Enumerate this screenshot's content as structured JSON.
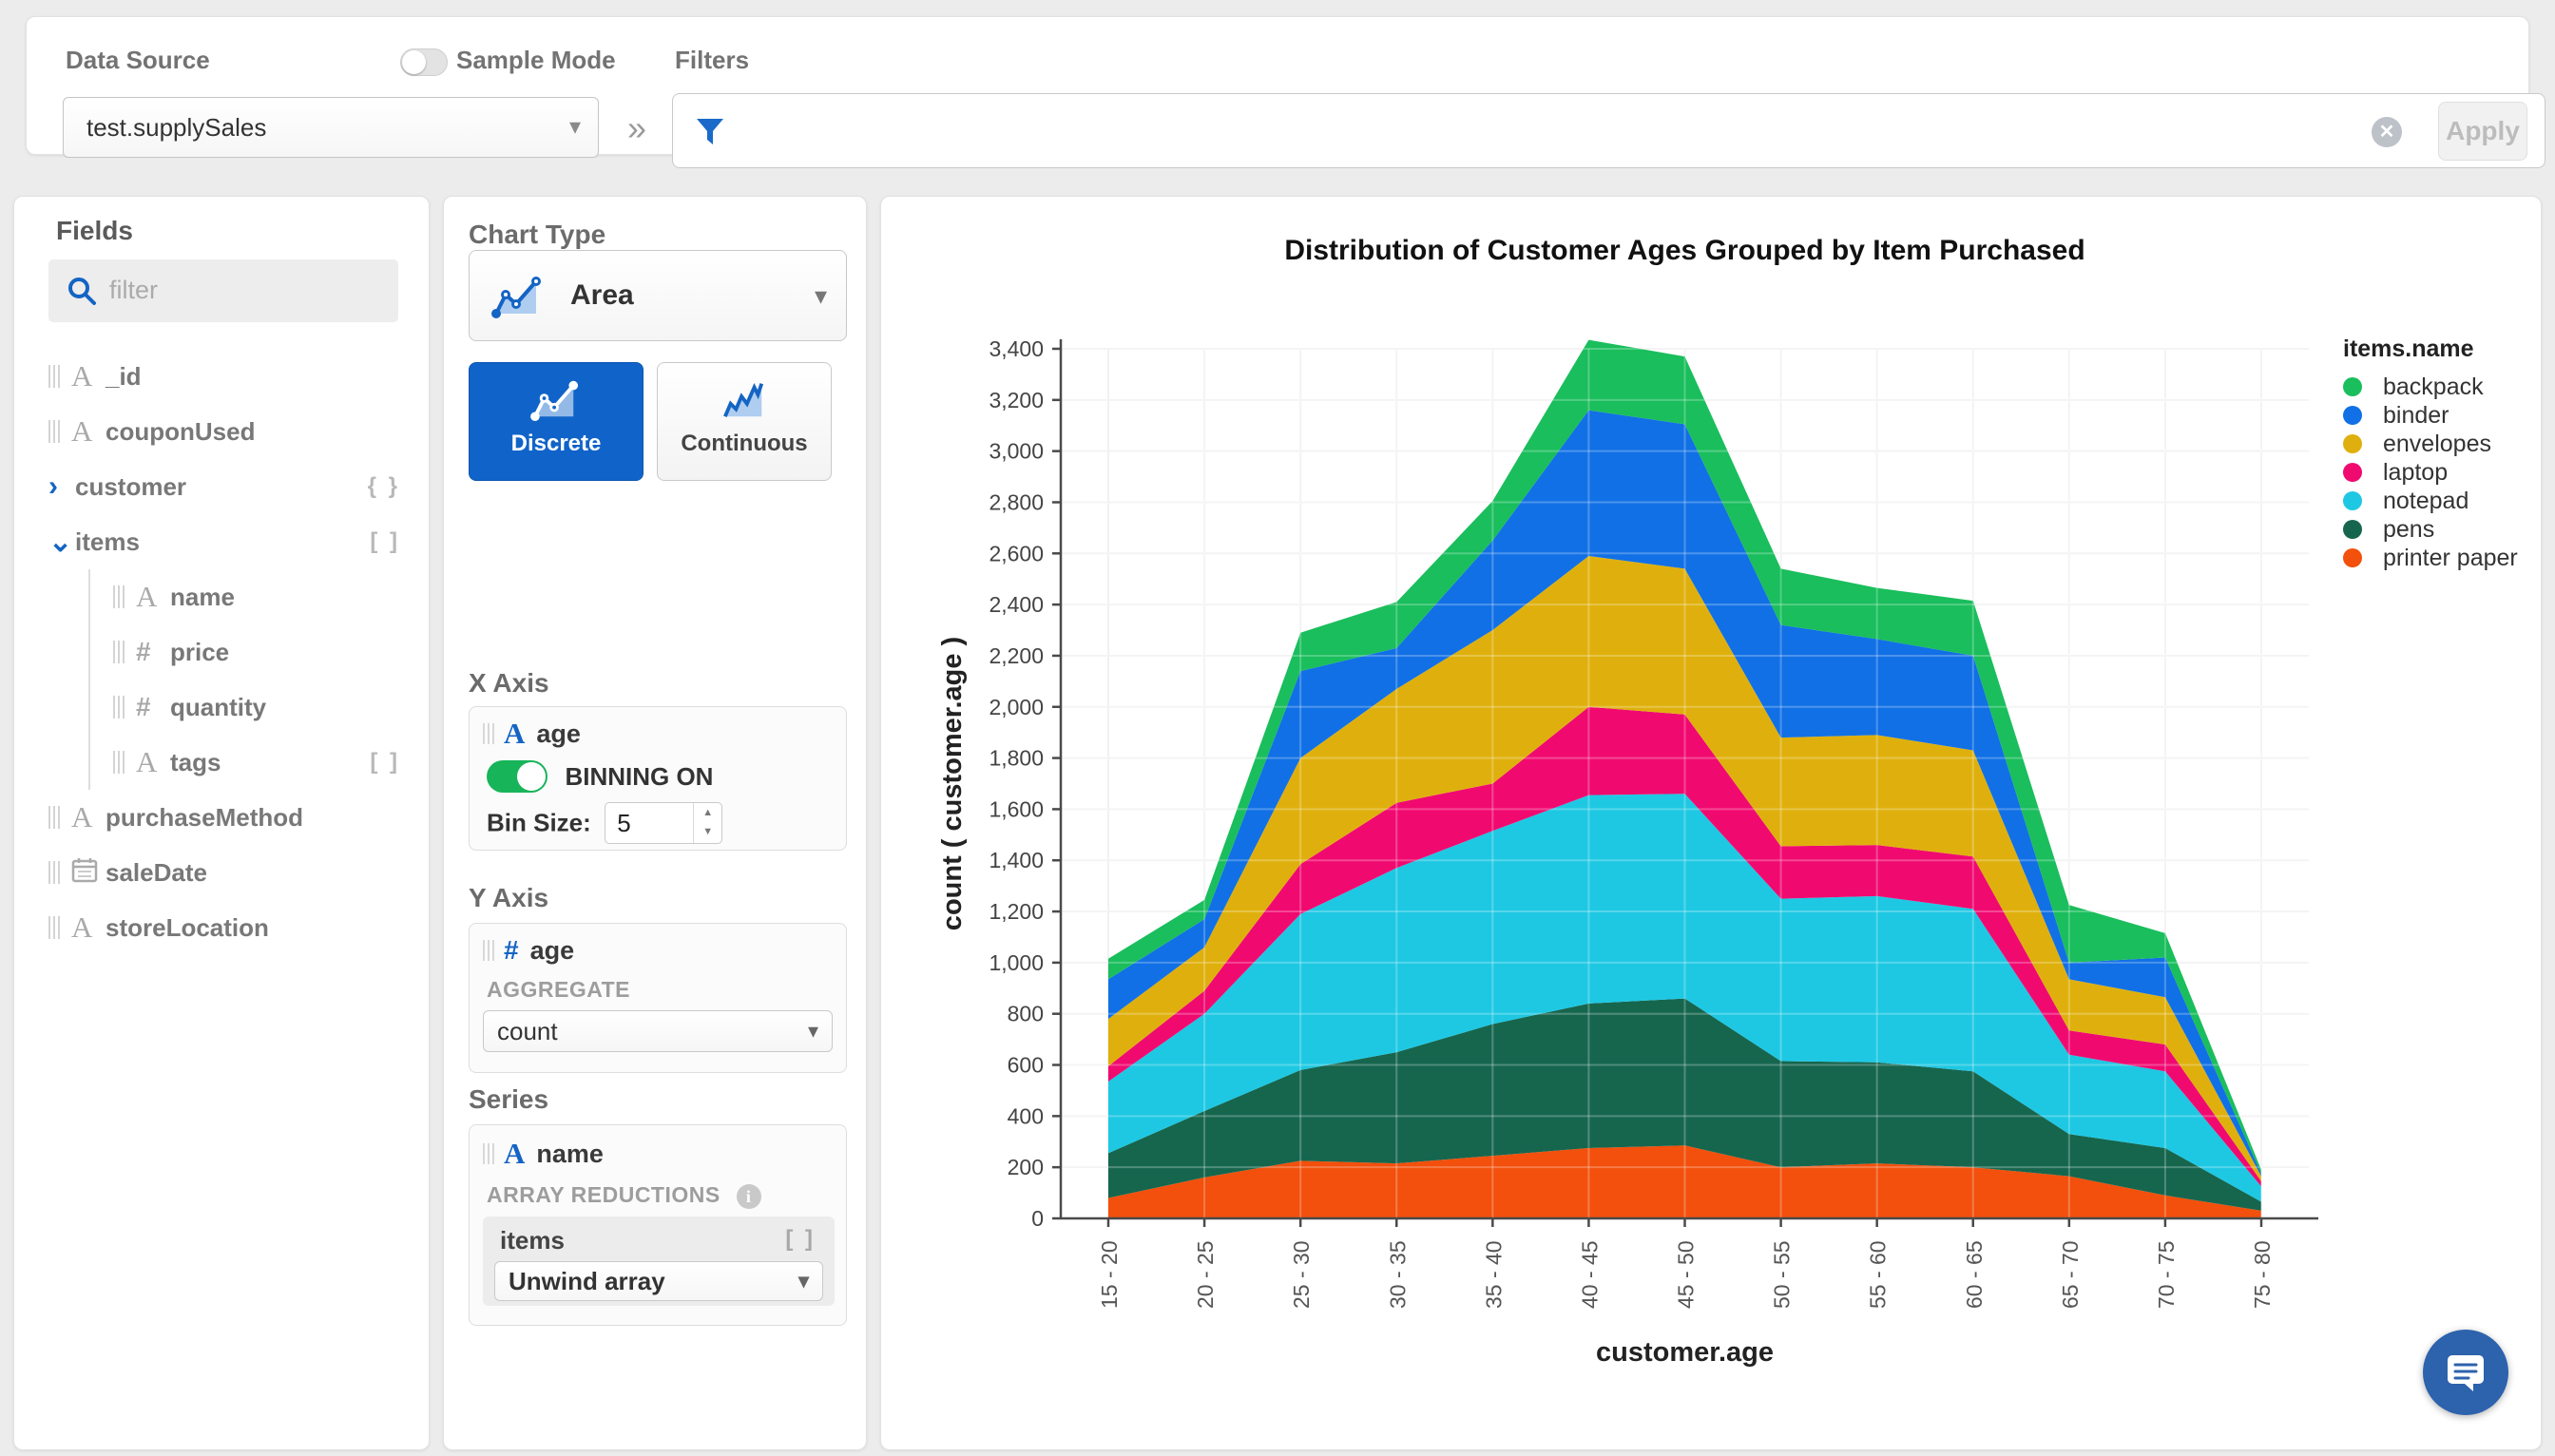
{
  "topbar": {
    "data_source_label": "Data Source",
    "data_source_value": "test.supplySales",
    "sample_mode_label": "Sample Mode",
    "sample_mode_on": false,
    "filters_label": "Filters",
    "filter_value": "",
    "apply_label": "Apply"
  },
  "icons": {
    "collapse_panel": "»",
    "chevron_down": "▾",
    "chevron_right": "›",
    "chevron_expanded": "⌄",
    "clear_x": "✕",
    "spinner_up": "▲",
    "spinner_down": "▼",
    "info": "i"
  },
  "fields_panel": {
    "title": "Fields",
    "filter_placeholder": "filter",
    "items": [
      {
        "name": "_id",
        "type": "string"
      },
      {
        "name": "couponUsed",
        "type": "string"
      },
      {
        "name": "customer",
        "type": "object",
        "expandable": true,
        "expanded": false,
        "badge": "{ }"
      },
      {
        "name": "items",
        "type": "array",
        "expandable": true,
        "expanded": true,
        "badge": "[ ]"
      },
      {
        "name": "name",
        "type": "string",
        "child": true
      },
      {
        "name": "price",
        "type": "number",
        "child": true
      },
      {
        "name": "quantity",
        "type": "number",
        "child": true
      },
      {
        "name": "tags",
        "type": "string",
        "child": true,
        "badge": "[ ]"
      },
      {
        "name": "purchaseMethod",
        "type": "string"
      },
      {
        "name": "saleDate",
        "type": "date"
      },
      {
        "name": "storeLocation",
        "type": "string"
      }
    ]
  },
  "encode_panel": {
    "chart_type_label": "Chart Type",
    "chart_type_value": "Area",
    "discrete_label": "Discrete",
    "continuous_label": "Continuous",
    "x_axis": {
      "label": "X Axis",
      "field": "age",
      "binning_label": "BINNING ON",
      "bin_size_label": "Bin Size:",
      "bin_size_value": "5"
    },
    "y_axis": {
      "label": "Y Axis",
      "field": "age",
      "aggregate_label": "AGGREGATE",
      "aggregate_value": "count"
    },
    "series": {
      "label": "Series",
      "field": "name",
      "reductions_label": "ARRAY REDUCTIONS",
      "reduction_field": "items",
      "reduction_badge": "[ ]",
      "reduction_value": "Unwind array"
    }
  },
  "chart_data": {
    "type": "area",
    "stacked": true,
    "title": "Distribution of Customer Ages Grouped by Item Purchased",
    "xlabel": "customer.age",
    "ylabel": "count ( customer.age )",
    "legend_title": "items.name",
    "legend_position": "right",
    "grid": true,
    "ylim": [
      0,
      3400
    ],
    "ytick_step": 200,
    "categories": [
      "15 - 20",
      "20 - 25",
      "25 - 30",
      "30 - 35",
      "35 - 40",
      "40 - 45",
      "45 - 50",
      "50 - 55",
      "55 - 60",
      "60 - 65",
      "65 - 70",
      "70 - 75",
      "75 - 80"
    ],
    "series": [
      {
        "name": "printer paper",
        "color": "#f2500c",
        "values": [
          80,
          160,
          225,
          215,
          245,
          275,
          285,
          200,
          215,
          200,
          165,
          90,
          30
        ]
      },
      {
        "name": "pens",
        "color": "#16664e",
        "values": [
          175,
          260,
          355,
          435,
          515,
          565,
          575,
          415,
          395,
          375,
          165,
          185,
          35
        ]
      },
      {
        "name": "notepad",
        "color": "#1ec8e3",
        "values": [
          280,
          380,
          610,
          720,
          755,
          815,
          800,
          635,
          650,
          635,
          310,
          300,
          60
        ]
      },
      {
        "name": "laptop",
        "color": "#f00a70",
        "values": [
          60,
          90,
          195,
          255,
          185,
          345,
          310,
          205,
          200,
          205,
          95,
          105,
          20
        ]
      },
      {
        "name": "envelopes",
        "color": "#dfb00d",
        "values": [
          185,
          170,
          415,
          445,
          600,
          590,
          570,
          425,
          430,
          415,
          200,
          185,
          20
        ]
      },
      {
        "name": "binder",
        "color": "#1170e5",
        "values": [
          155,
          110,
          340,
          160,
          350,
          570,
          565,
          440,
          375,
          370,
          65,
          155,
          10
        ]
      },
      {
        "name": "backpack",
        "color": "#1abe5c",
        "values": [
          80,
          75,
          150,
          180,
          155,
          275,
          265,
          220,
          200,
          215,
          225,
          95,
          15
        ]
      }
    ],
    "legend_order": [
      "backpack",
      "binder",
      "envelopes",
      "laptop",
      "notepad",
      "pens",
      "printer paper"
    ]
  }
}
